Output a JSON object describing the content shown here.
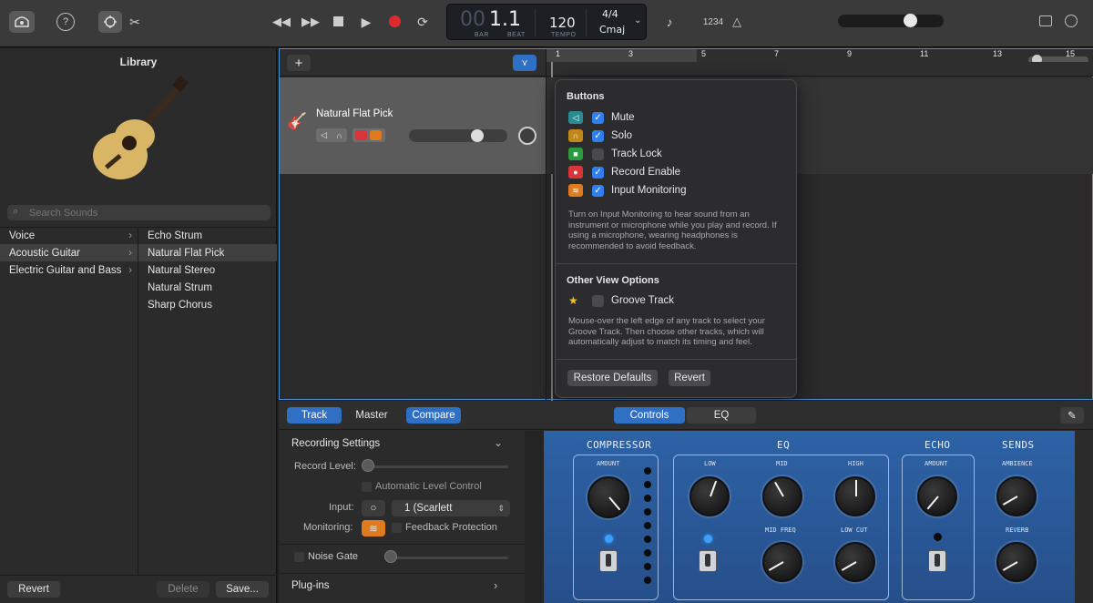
{
  "toolbar": {
    "lcd": {
      "bar_digits": "00",
      "bar_beat": "1.1",
      "bar_label": "BAR",
      "beat_label": "BEAT",
      "tempo": "120",
      "tempo_label": "TEMPO",
      "timesig": "4/4",
      "key": "Cmaj"
    },
    "count_in": "1234",
    "help": "?"
  },
  "library": {
    "title": "Library",
    "search_placeholder": "Search Sounds",
    "categories": [
      {
        "label": "Voice"
      },
      {
        "label": "Acoustic Guitar"
      },
      {
        "label": "Electric Guitar and Bass"
      }
    ],
    "sounds": [
      {
        "label": "Echo Strum"
      },
      {
        "label": "Natural Flat Pick"
      },
      {
        "label": "Natural Stereo"
      },
      {
        "label": "Natural Strum"
      },
      {
        "label": "Sharp Chorus"
      }
    ],
    "revert": "Revert",
    "delete": "Delete",
    "save": "Save..."
  },
  "track": {
    "name": "Natural Flat Pick"
  },
  "ruler": [
    "1",
    "3",
    "5",
    "7",
    "9",
    "11",
    "13",
    "15"
  ],
  "popover": {
    "buttons_title": "Buttons",
    "items": [
      {
        "label": "Mute",
        "checked": true
      },
      {
        "label": "Solo",
        "checked": true
      },
      {
        "label": "Track Lock",
        "checked": false
      },
      {
        "label": "Record Enable",
        "checked": true
      },
      {
        "label": "Input Monitoring",
        "checked": true
      }
    ],
    "note1": "Turn on Input Monitoring to hear sound from an instrument or microphone while you play and record. If using a microphone, wearing headphones is recommended to avoid feedback.",
    "other_title": "Other View Options",
    "groove": "Groove Track",
    "note2": "Mouse-over the left edge of any track to select your Groove Track. Then choose other tracks, which will automatically adjust to match its timing and feel.",
    "restore": "Restore Defaults",
    "revert": "Revert"
  },
  "bottom": {
    "tabs": {
      "track": "Track",
      "master": "Master",
      "compare": "Compare",
      "controls": "Controls",
      "eq": "EQ"
    },
    "recording_settings": "Recording Settings",
    "record_level": "Record Level:",
    "auto_level": "Automatic Level Control",
    "input": "Input:",
    "input_value": "1  (Scarlett",
    "monitoring": "Monitoring:",
    "feedback": "Feedback Protection",
    "noise_gate": "Noise Gate",
    "plugins": "Plug-ins"
  },
  "amp": {
    "compressor": "COMPRESSOR",
    "eq": "EQ",
    "echo": "ECHO",
    "sends": "SENDS",
    "amount": "AMOUNT",
    "low": "LOW",
    "mid": "MID",
    "high": "HIGH",
    "mid_freq": "MID FREQ",
    "low_cut": "LOW CUT",
    "echo_amount": "AMOUNT",
    "ambience": "AMBIENCE",
    "reverb": "REVERB"
  }
}
